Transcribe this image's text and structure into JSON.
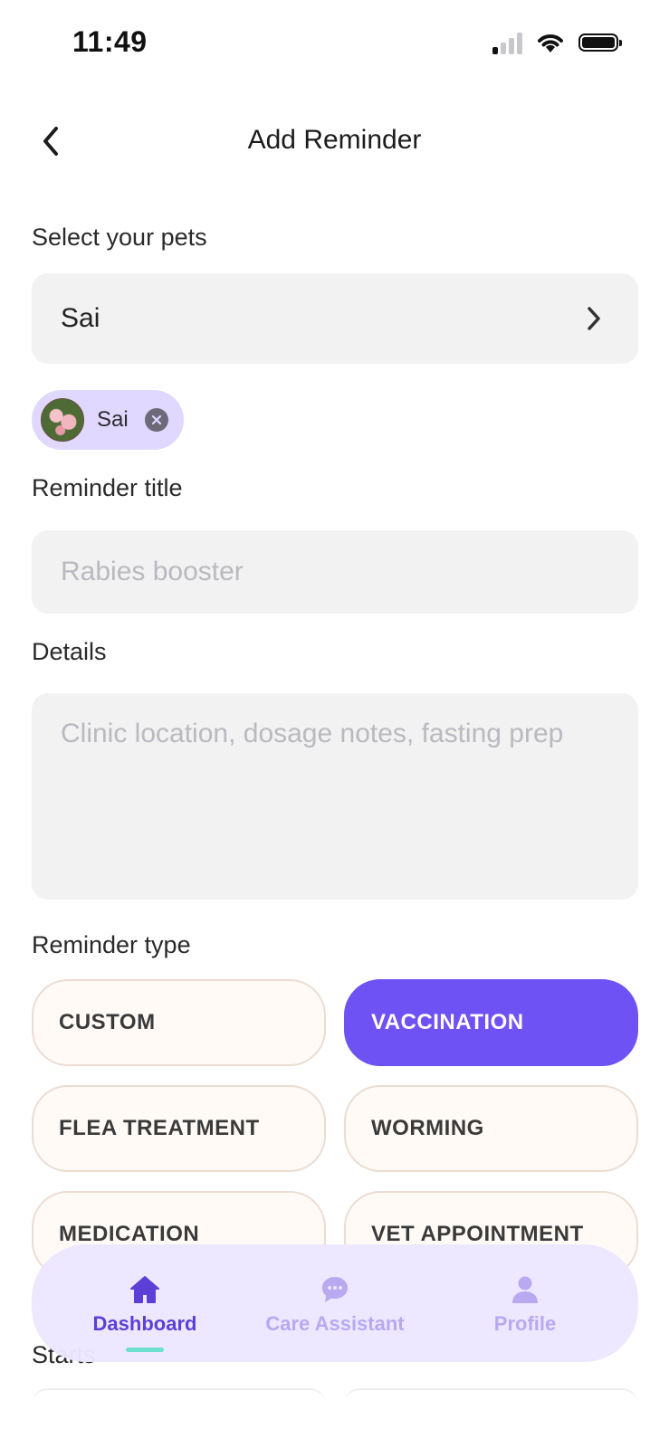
{
  "status_bar": {
    "time": "11:49"
  },
  "header": {
    "title": "Add Reminder",
    "back_icon": "chevron-left-icon"
  },
  "pets": {
    "label": "Select your pets",
    "selected_value": "Sai",
    "chips": [
      {
        "name": "Sai"
      }
    ]
  },
  "reminder_title": {
    "label": "Reminder title",
    "value": "",
    "placeholder": "Rabies booster"
  },
  "details": {
    "label": "Details",
    "value": "",
    "placeholder": "Clinic location, dosage notes, fasting prep"
  },
  "reminder_type": {
    "label": "Reminder type",
    "options": [
      {
        "label": "CUSTOM",
        "selected": false
      },
      {
        "label": "VACCINATION",
        "selected": true
      },
      {
        "label": "FLEA TREATMENT",
        "selected": false
      },
      {
        "label": "WORMING",
        "selected": false
      },
      {
        "label": "MEDICATION",
        "selected": false
      },
      {
        "label": "VET APPOINTMENT",
        "selected": false
      }
    ]
  },
  "starts": {
    "label": "Starts"
  },
  "bottom_nav": {
    "items": [
      {
        "label": "Dashboard",
        "icon": "home-icon",
        "active": true
      },
      {
        "label": "Care Assistant",
        "icon": "chat-bubble-icon",
        "active": false
      },
      {
        "label": "Profile",
        "icon": "person-icon",
        "active": false
      }
    ]
  },
  "colors": {
    "accent": "#6f52f3",
    "chip_background": "#e0d8ff",
    "nav_background": "#ece7ff",
    "nav_indicator": "#6ee0cf",
    "field_background": "#f2f2f2"
  }
}
